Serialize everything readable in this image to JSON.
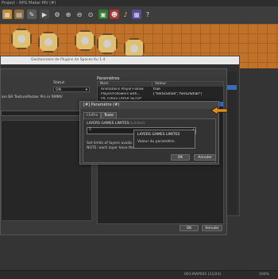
{
  "app": {
    "title": "Project - RPG Maker MV (#)"
  },
  "plugin_manager": {
    "title": "Gestionnaire de Plugins de Spaces Ku 1.4",
    "text_fragment": "ion BA TexturePacker Pro in RMMV"
  },
  "plugin_editor": {
    "status_label": "Statut:",
    "status_value": "ON",
    "params_title": "Paramètres",
    "columns": {
      "name": "Nom",
      "value": "Valeur"
    },
    "rows": [
      {
        "name": "Animations Player-Follow",
        "value": "true",
        "selected": false
      },
      {
        "name": "Player/Followers with...",
        "value": "[\"hero1Small\",\"hero2Small\"]",
        "selected": false
      },
      {
        "name": "PICTURES LAYER SETUP",
        "value": "",
        "selected": false
      },
      {
        "name": "",
        "value": "",
        "selected": true
      }
    ],
    "ok_label": "OK",
    "cancel_label": "Annuler"
  },
  "param_dialog": {
    "title": "[#] Paramètre (#)",
    "tabs": [
      "Chiffre",
      "Texte"
    ],
    "active_tab": 1,
    "field_label": "LAYERS GAMES LIMITES",
    "field_hint": "(Limites)",
    "input_value": "5",
    "description_line1": "Set limits of layers availa",
    "description_line2": "NOTE: each layer have the",
    "ok_label": "OK",
    "cancel_label": "Annuler"
  },
  "tooltip": {
    "title": "LAYERS GAMES LIMITES",
    "text": "Valeur du paramètre."
  },
  "status_bar": {
    "map": "001:MAP001 (11/23)",
    "zoom": "100%"
  }
}
